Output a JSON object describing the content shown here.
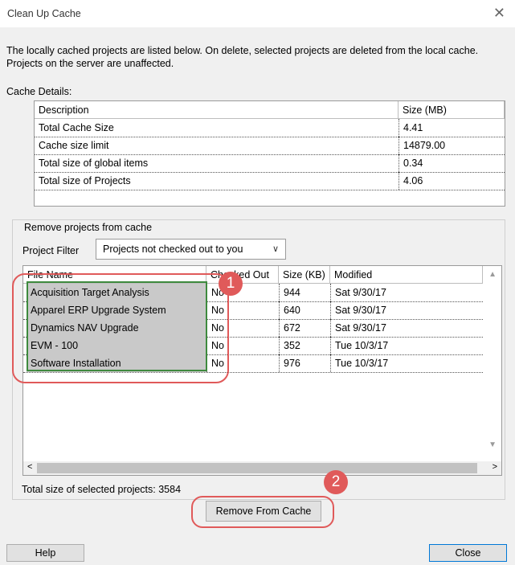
{
  "window": {
    "title": "Clean Up Cache"
  },
  "intro_text": "The locally cached projects are listed below. On delete, selected projects are deleted from the local cache. Projects on the server are unaffected.",
  "cache_details": {
    "label": "Cache Details:",
    "columns": [
      "Description",
      "Size (MB)"
    ],
    "rows": [
      {
        "description": "Total Cache Size",
        "size": "4.41"
      },
      {
        "description": "Cache size limit",
        "size": "14879.00"
      },
      {
        "description": "Total size of global items",
        "size": "0.34"
      },
      {
        "description": "Total size of Projects",
        "size": "4.06"
      }
    ]
  },
  "remove_group": {
    "label": "Remove projects from cache",
    "filter_label": "Project Filter",
    "filter_value": "Projects not checked out to you",
    "columns": [
      "File Name",
      "Checked Out",
      "Size (KB)",
      "Modified"
    ],
    "rows": [
      {
        "name": "Acquisition Target Analysis",
        "checked_out": "No",
        "size": "944",
        "modified": "Sat 9/30/17"
      },
      {
        "name": "Apparel ERP Upgrade System",
        "checked_out": "No",
        "size": "640",
        "modified": "Sat 9/30/17"
      },
      {
        "name": "Dynamics NAV Upgrade",
        "checked_out": "No",
        "size": "672",
        "modified": "Sat 9/30/17"
      },
      {
        "name": "EVM - 100",
        "checked_out": "No",
        "size": "352",
        "modified": "Tue 10/3/17"
      },
      {
        "name": "Software Installation",
        "checked_out": "No",
        "size": "976",
        "modified": "Tue 10/3/17"
      }
    ]
  },
  "total_selected": "Total size of selected projects: 3584",
  "buttons": {
    "remove": "Remove From Cache",
    "help": "Help",
    "close": "Close"
  },
  "callouts": [
    "1",
    "2"
  ],
  "colors": {
    "callout": "#e05a5a",
    "selection_border": "#3e8a3e",
    "selected_row": "#c9c9c9"
  }
}
